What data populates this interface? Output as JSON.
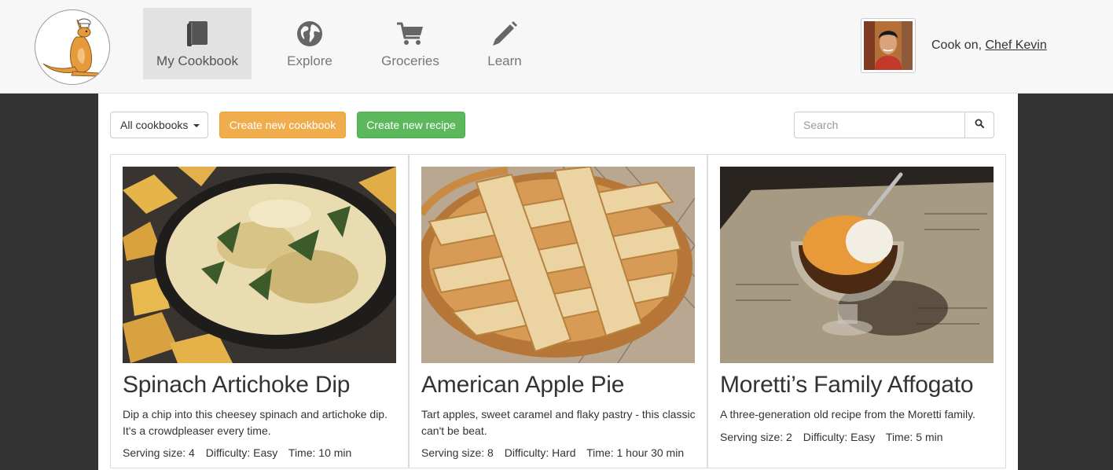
{
  "header": {
    "nav": [
      {
        "label": "My Cookbook",
        "icon": "book-icon",
        "active": true
      },
      {
        "label": "Explore",
        "icon": "globe-icon",
        "active": false
      },
      {
        "label": "Groceries",
        "icon": "cart-icon",
        "active": false
      },
      {
        "label": "Learn",
        "icon": "pencil-icon",
        "active": false
      }
    ],
    "user_prefix": "Cook on, ",
    "user_name": "Chef Kevin"
  },
  "toolbar": {
    "cookbook_filter": "All cookbooks",
    "create_cookbook": "Create new cookbook",
    "create_recipe": "Create new recipe",
    "search_placeholder": "Search"
  },
  "recipes": [
    {
      "title": "Spinach Artichoke Dip",
      "description": "Dip a chip into this cheesey spinach and artichoke dip. It's a crowdpleaser every time.",
      "serving": "Serving size: 4",
      "difficulty": "Difficulty: Easy",
      "time": "Time: 10 min"
    },
    {
      "title": "American Apple Pie",
      "description": "Tart apples, sweet caramel and flaky pastry - this classic can't be beat.",
      "serving": "Serving size: 8",
      "difficulty": "Difficulty: Hard",
      "time": "Time: 1 hour 30 min"
    },
    {
      "title": "Moretti’s Family Affogato",
      "description": "A three-generation old recipe from the Moretti family.",
      "serving": "Serving size: 2",
      "difficulty": "Difficulty: Easy",
      "time": "Time: 5 min"
    }
  ],
  "colors": {
    "warning": "#f0ad4e",
    "success": "#5cb85c",
    "header_bg": "#f7f7f7",
    "page_bg": "#333333"
  }
}
